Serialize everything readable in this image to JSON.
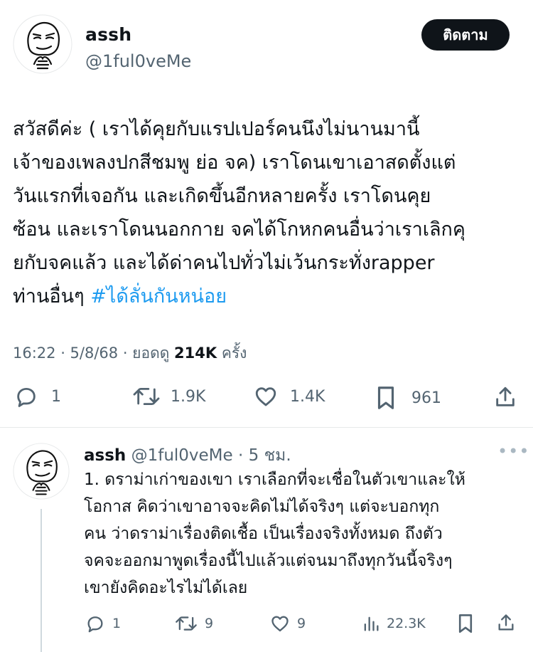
{
  "tweet": {
    "author_name": "assh",
    "author_handle": "@1ful0veMe",
    "follow_label": "ติดตาม",
    "text_lines": [
      "สวัสดีค่ะ ( เราได้คุยกับแรปเปอร์คนนึงไม่นานมานี้",
      "เจ้าของเพลงปกสีชมพู ย่อ จค) เราโดนเขาเอาสดตั้งแต่",
      "วันแรกที่เจอกัน และเกิดขึ้นอีกหลายครั้ง เราโดนคุย",
      "ซ้อน และเราโดนนอกกาย จคได้โกหกคนอื่นว่าเราเลิกคุ",
      "ยกับจคแล้ว และได้ด่าคนไปทั่วไม่เว้นกระทั่งrapper",
      "ท่านอื่นๆ "
    ],
    "hashtag": "#ได้ลั่นกันหน่อย",
    "timestamp": "16:22 · 5/8/68 · ยอดดู ",
    "views": "214K",
    "views_suffix": " ครั้ง",
    "actions": {
      "replies": "1",
      "reposts": "1.9K",
      "likes": "1.4K",
      "bookmarks": "961"
    }
  },
  "reply": {
    "author_name": "assh",
    "author_handle": "@1ful0veMe",
    "time": " · 5 ชม.",
    "more": "•••",
    "text_lines": [
      "1. ดราม่าเก่าของเขา เราเลือกที่จะเชื่อในตัวเขาและให้",
      "โอกาส คิดว่าเขาอาจจะคิดไม่ได้จริงๆ แต่จะบอกทุก",
      "คน ว่าดราม่าเรื่องติดเชื้อ เป็นเรื่องจริงทั้งหมด ถึงตัว",
      "จคจะออกมาพูดเรื่องนี้ไปแล้วแต่จนมาถึงทุกวันนี้จริงๆ",
      "เขายังคิดอะไรไม่ได้เลย"
    ],
    "actions": {
      "replies": "1",
      "reposts": "9",
      "likes": "9",
      "views": "22.3K"
    }
  },
  "icons": {
    "reply": "speech-bubble-icon",
    "repost": "repost-arrows-icon",
    "like": "heart-icon",
    "bookmark": "bookmark-icon",
    "share": "share-upload-icon",
    "views": "bar-chart-icon",
    "avatar": "smug-face-avatar"
  },
  "colors": {
    "text": "#0f1419",
    "secondary": "#536471",
    "link": "#1d9bf0",
    "follow_bg": "#0f1419"
  }
}
